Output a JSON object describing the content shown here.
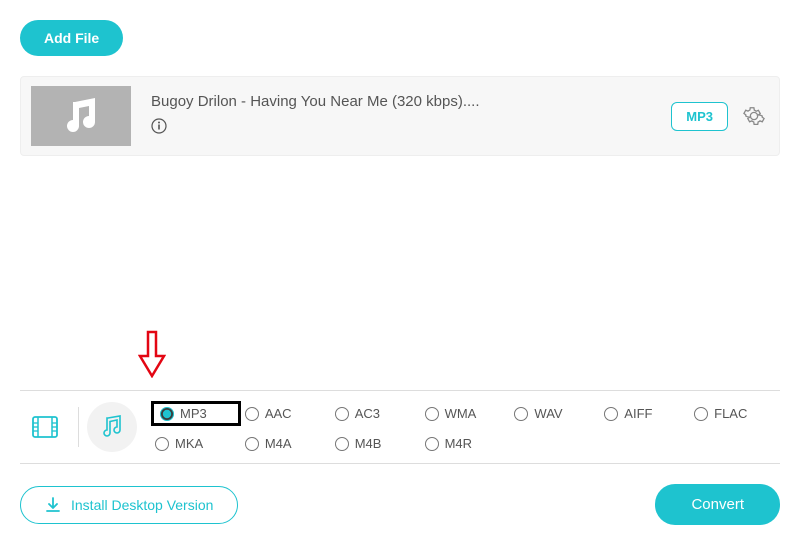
{
  "toolbar": {
    "add_file_label": "Add File"
  },
  "file": {
    "title": "Bugoy Drilon - Having You Near Me (320 kbps)....",
    "badge": "MP3"
  },
  "formats": {
    "row1": [
      "MP3",
      "AAC",
      "AC3",
      "WMA",
      "WAV",
      "AIFF",
      "FLAC"
    ],
    "row2": [
      "MKA",
      "M4A",
      "M4B",
      "M4R"
    ],
    "selected": "MP3"
  },
  "footer": {
    "install_label": "Install Desktop Version",
    "convert_label": "Convert"
  },
  "colors": {
    "accent": "#1ec3cf"
  }
}
